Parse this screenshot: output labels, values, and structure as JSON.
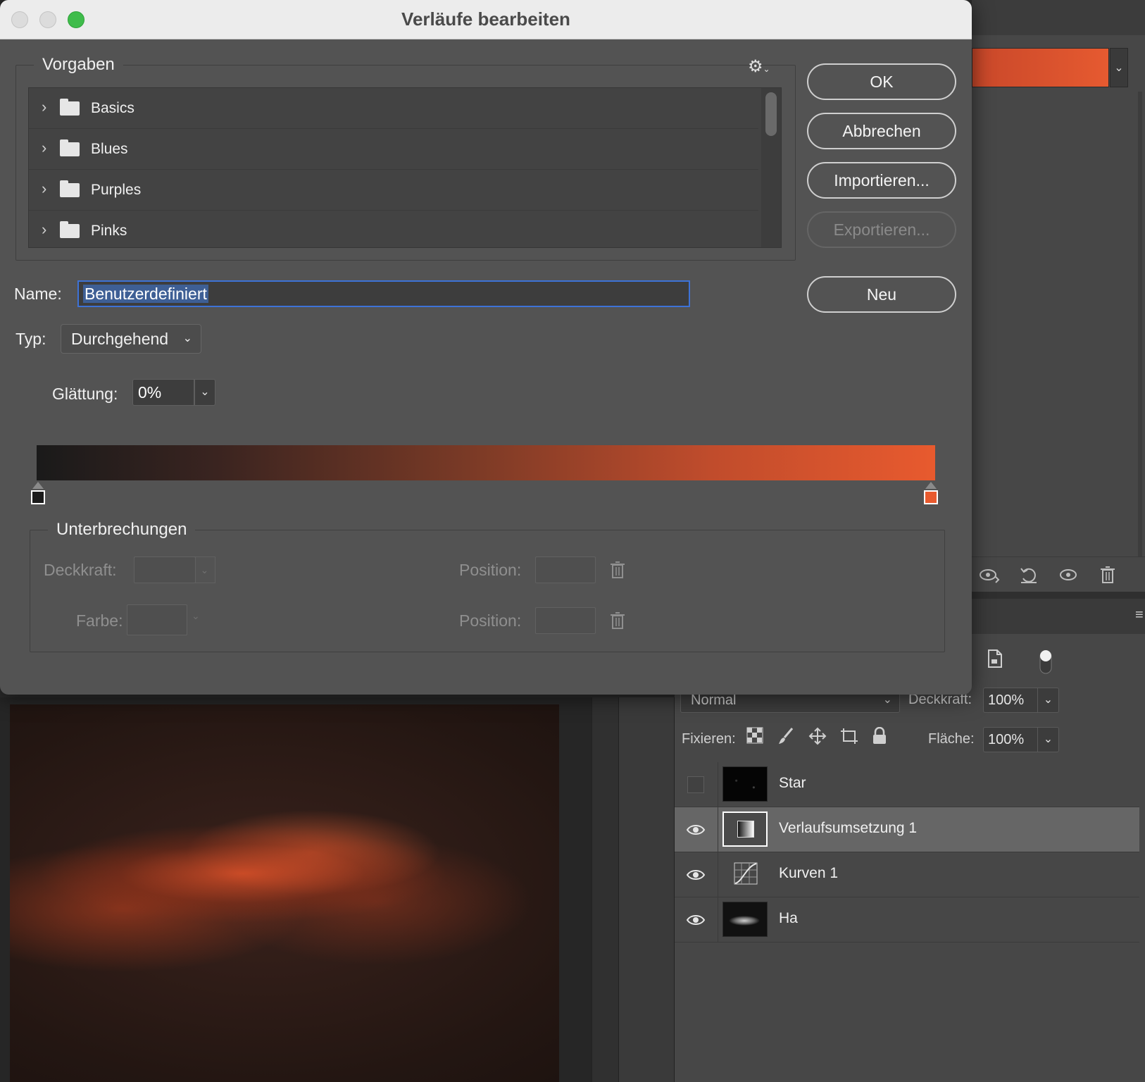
{
  "dialog": {
    "title": "Verläufe bearbeiten",
    "presets": {
      "legend": "Vorgaben",
      "items": [
        {
          "label": "Basics"
        },
        {
          "label": "Blues"
        },
        {
          "label": "Purples"
        },
        {
          "label": "Pinks"
        }
      ]
    },
    "buttons": {
      "ok": "OK",
      "cancel": "Abbrechen",
      "import": "Importieren...",
      "export": "Exportieren...",
      "new": "Neu"
    },
    "name": {
      "label": "Name:",
      "value": "Benutzerdefiniert"
    },
    "type": {
      "label": "Typ:",
      "value": "Durchgehend"
    },
    "smoothing": {
      "label": "Glättung:",
      "value": "0%"
    },
    "gradient": {
      "start_color": "#1a1a1a",
      "end_color": "#e85a2e",
      "stops": [
        {
          "position": 0,
          "color": "#1a1a1a"
        },
        {
          "position": 100,
          "color": "#e85a2e"
        }
      ]
    },
    "stops_group": {
      "legend": "Unterbrechungen",
      "opacity_label": "Deckkraft:",
      "color_label": "Farbe:",
      "position_label": "Position:"
    }
  },
  "layers": {
    "blend_mode": "Normal",
    "opacity_label": "Deckkraft:",
    "opacity_value": "100%",
    "lock_label": "Fixieren:",
    "fill_label": "Fläche:",
    "fill_value": "100%",
    "items": [
      {
        "name": "Star",
        "visible": false
      },
      {
        "name": "Verlaufsumsetzung 1",
        "visible": true,
        "selected": true
      },
      {
        "name": "Kurven 1",
        "visible": true
      },
      {
        "name": "Ha",
        "visible": true
      }
    ]
  },
  "colors": {
    "accent_selection": "#3d72d6",
    "gradient_end": "#e85a2e"
  }
}
